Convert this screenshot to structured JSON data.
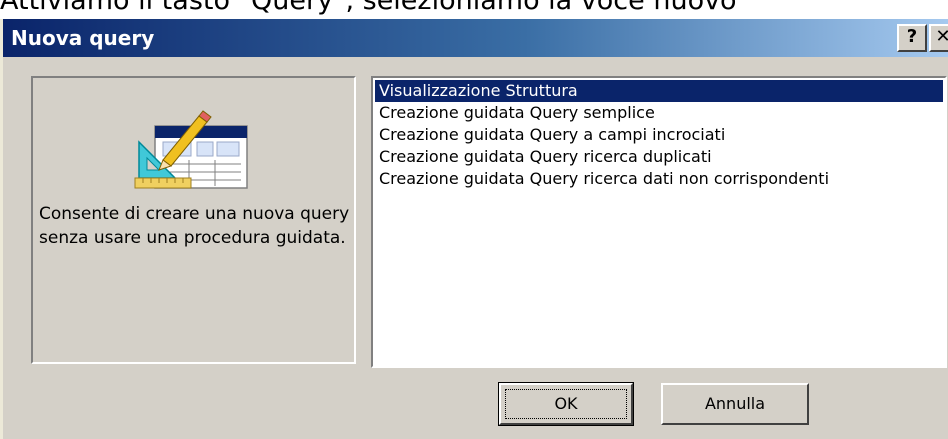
{
  "caption": "Attiviamo il tasto \"Query\", selezioniamo la voce nuovo",
  "dialog": {
    "title": "Nuova query",
    "help_label": "?",
    "close_label": "✕"
  },
  "preview": {
    "description": "Consente di creare una nuova query senza usare una procedura guidata.",
    "icon": "query-design-icon"
  },
  "query_types": [
    {
      "label": "Visualizzazione Struttura",
      "selected": true
    },
    {
      "label": "Creazione guidata Query semplice",
      "selected": false
    },
    {
      "label": "Creazione guidata Query a campi incrociati",
      "selected": false
    },
    {
      "label": "Creazione guidata Query ricerca duplicati",
      "selected": false
    },
    {
      "label": "Creazione guidata Query ricerca dati non corrispondenti",
      "selected": false
    }
  ],
  "buttons": {
    "ok_label": "OK",
    "cancel_label": "Annulla"
  },
  "colors": {
    "titlebar_start": "#0a246a",
    "titlebar_end": "#a6caf0",
    "selection": "#0a246a",
    "dialog_face": "#d4d0c8"
  }
}
